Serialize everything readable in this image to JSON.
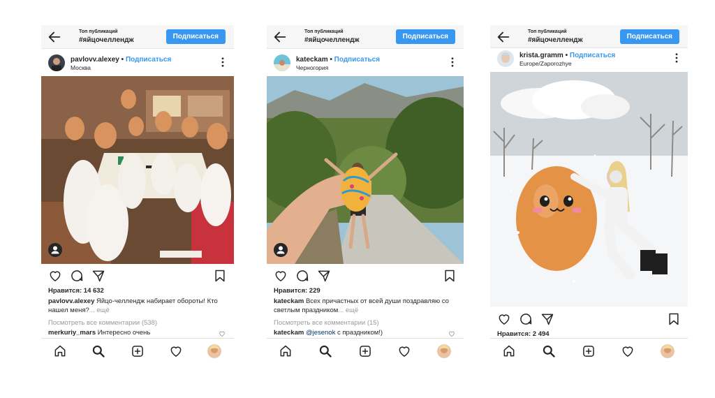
{
  "header": {
    "subtitle": "Топ публикаций",
    "hashtag": "#яйцочеллендж",
    "follow_button": "Подписаться"
  },
  "posts": [
    {
      "username": "pavlovv.alexey",
      "follow_link": "Подписаться",
      "location": "Москва",
      "likes": "Нравится: 14 632",
      "caption_user": "pavlovv.alexey",
      "caption_text": " Яйцо-челлендж набирает обороты! Кто нашел меня?",
      "caption_more": "... ещё",
      "view_comments": "Посмотреть все комментарии (538)",
      "comment_user": "merkuriy_mars",
      "comment_text": " Интересно очень"
    },
    {
      "username": "kateckam",
      "follow_link": "Подписаться",
      "location": "Черногория",
      "likes": "Нравится: 229",
      "caption_user": "kateckam",
      "caption_text": " Всех причастных от всей души поздравляю со светлым праздником",
      "caption_more": "... ещё",
      "view_comments": "Посмотреть все комментарии (15)",
      "comment_user": "kateckam",
      "comment_mention": "@jesenok",
      "comment_text": " с праздником!)"
    },
    {
      "username": "krista.gramm",
      "follow_link": "Подписаться",
      "location": "Europe/Zaporozhye",
      "likes": "Нравится: 2 494"
    }
  ],
  "icons": [
    "back-arrow-icon",
    "more-icon",
    "heart-icon",
    "comment-icon",
    "share-icon",
    "bookmark-icon",
    "home-icon",
    "search-icon",
    "add-icon",
    "activity-heart-icon",
    "user-tag-icon"
  ],
  "colors": {
    "accent": "#3897f0",
    "text": "#262626",
    "muted": "#999999"
  }
}
